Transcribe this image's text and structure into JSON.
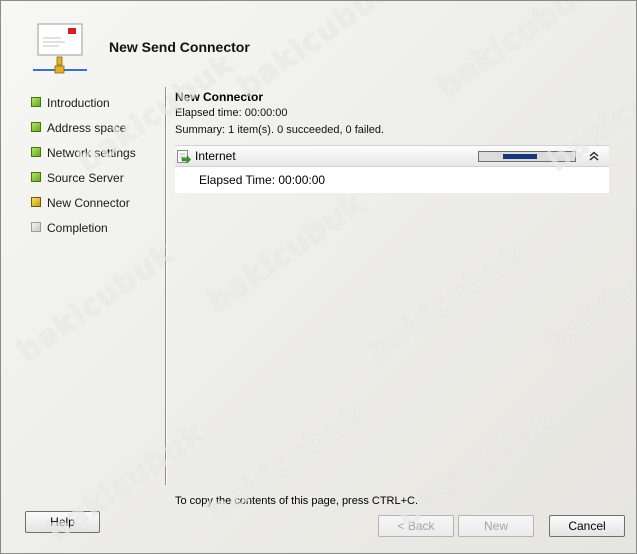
{
  "window": {
    "title": "New Send Connector"
  },
  "nav": {
    "items": [
      {
        "label": "Introduction",
        "state": "done"
      },
      {
        "label": "Address space",
        "state": "done"
      },
      {
        "label": "Network settings",
        "state": "done"
      },
      {
        "label": "Source Server",
        "state": "done"
      },
      {
        "label": "New Connector",
        "state": "current"
      },
      {
        "label": "Completion",
        "state": "pending"
      }
    ]
  },
  "content": {
    "section_title": "New Connector",
    "elapsed_time": "Elapsed time: 00:00:00",
    "summary": "Summary: 1 item(s). 0 succeeded, 0 failed.",
    "task": {
      "name": "Internet",
      "progress_fraction": 0.35,
      "progress_offset_fraction": 0.25,
      "detail": "Elapsed Time: 00:00:00",
      "icon": "task-arrow-icon",
      "collapse_icon": "double-chevron-up-icon"
    }
  },
  "footer": {
    "copy_hint": "To copy the contents of this page, press CTRL+C.",
    "help_label": "Help",
    "back_label": "< Back",
    "next_label": "New",
    "cancel_label": "Cancel"
  },
  "watermark": {
    "text": "bakicubuk"
  },
  "colors": {
    "step_done": "#66a81c",
    "step_current": "#c49a08",
    "step_pending": "#c8c8c8",
    "progress_fill": "#17367a"
  }
}
